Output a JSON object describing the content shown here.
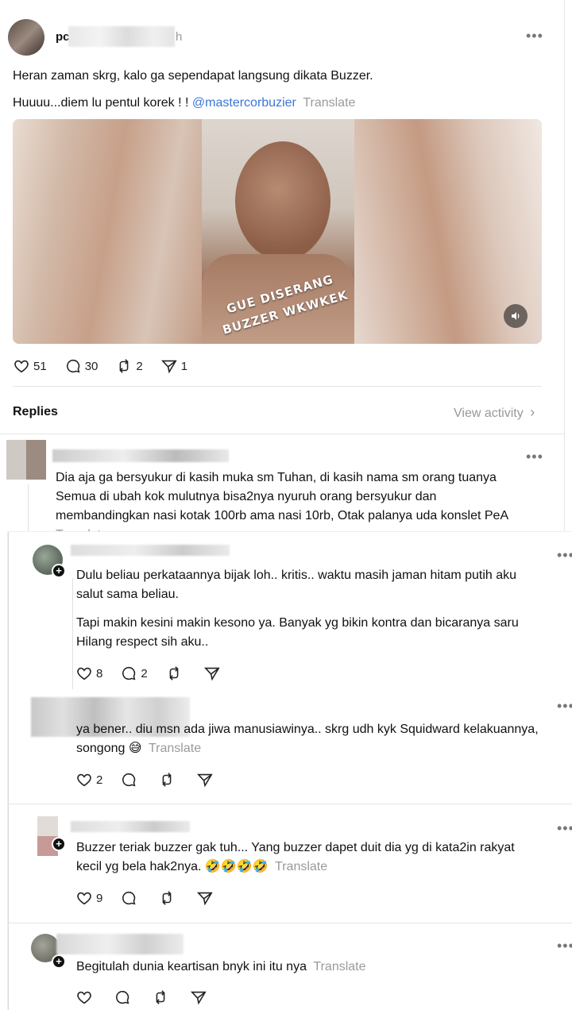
{
  "post": {
    "username_partial": "pc",
    "time_partial": "h",
    "line1": "Heran zaman skrg, kalo ga sependapat langsung dikata Buzzer.",
    "line2_prefix": "Huuuu...diem lu pentul korek ! !",
    "mention": "@mastercorbuzier",
    "translate": "Translate",
    "video_caption_line1": "GUE DISERANG",
    "video_caption_line2": "BUZZER WKWKEK",
    "sound_icon": "speaker-icon",
    "likes": "51",
    "comments": "30",
    "reposts": "2",
    "shares": "1"
  },
  "replies_header": {
    "title": "Replies",
    "view_activity": "View activity",
    "chevron": "›"
  },
  "reply1": {
    "line1": "Dia aja ga bersyukur di kasih muka sm Tuhan, di kasih nama sm orang tuanya",
    "line2": "Semua di ubah kok mulutnya bisa2nya nyuruh orang bersyukur dan",
    "line3": "membandingkan nasi kotak 100rb ama nasi 10rb, Otak palanya uda konslet PeA",
    "translate_cut": "Translate"
  },
  "reply2": {
    "line1": "Dulu beliau perkataannya bijak loh.. kritis.. waktu masih jaman hitam putih aku",
    "line2": "salut sama beliau.",
    "line3": "Tapi makin kesini makin kesono ya. Banyak yg bikin kontra dan bicaranya saru",
    "line4": "Hilang respect sih aku..",
    "likes": "8",
    "comments": "2"
  },
  "reply3": {
    "line1": "ya bener.. diu msn ada jiwa manusiawinya.. skrg udh kyk Squidward kelakuannya,",
    "line2": "songong",
    "emoji": "😅",
    "translate": "Translate",
    "likes": "2"
  },
  "reply4": {
    "line1": "Buzzer teriak buzzer gak tuh... Yang buzzer dapet duit dia yg di kata2in rakyat",
    "line2": "kecil yg bela hak2nya.",
    "emojis": "🤣🤣🤣🤣",
    "translate": "Translate",
    "likes": "9"
  },
  "reply5": {
    "line1": "Begitulah dunia keartisan bnyk ini itu nya",
    "translate": "Translate"
  },
  "colors": {
    "link": "#3a76d6",
    "muted": "#9a9a9a",
    "separator": "#e5e5e5"
  }
}
